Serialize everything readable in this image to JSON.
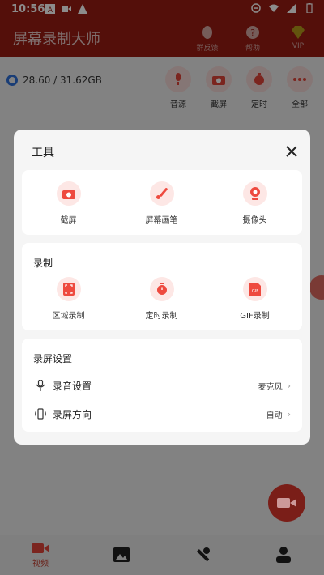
{
  "status": {
    "time": "10:56"
  },
  "app": {
    "title": "屏幕录制大师",
    "actions": [
      {
        "label": "群反馈",
        "icon": "qq-penguin-icon"
      },
      {
        "label": "帮助",
        "icon": "help-icon"
      },
      {
        "label": "VIP",
        "icon": "vip-diamond-icon"
      }
    ]
  },
  "storage": {
    "text": "28.60 / 31.62GB"
  },
  "quick": [
    {
      "label": "音源",
      "icon": "microphone-icon"
    },
    {
      "label": "截屏",
      "icon": "camera-icon"
    },
    {
      "label": "定时",
      "icon": "timer-icon"
    },
    {
      "label": "全部",
      "icon": "more-dots-icon"
    }
  ],
  "dialog": {
    "title": "工具",
    "tools": [
      {
        "label": "截屏",
        "icon": "camera-icon"
      },
      {
        "label": "屏幕画笔",
        "icon": "brush-icon"
      },
      {
        "label": "摄像头",
        "icon": "webcam-icon"
      }
    ],
    "record": {
      "title": "录制",
      "items": [
        {
          "label": "区域录制",
          "icon": "region-record-icon"
        },
        {
          "label": "定时录制",
          "icon": "timer-icon"
        },
        {
          "label": "GIF录制",
          "icon": "gif-icon"
        }
      ]
    },
    "settings": {
      "title": "录屏设置",
      "rows": [
        {
          "label": "录音设置",
          "value": "麦克风",
          "icon": "microphone-icon"
        },
        {
          "label": "录屏方向",
          "value": "自动",
          "icon": "rotate-icon"
        }
      ]
    }
  },
  "nav": [
    {
      "label": "视频",
      "icon": "video-icon"
    },
    {
      "label": "",
      "icon": "image-icon"
    },
    {
      "label": "",
      "icon": "wrench-icon"
    },
    {
      "label": "",
      "icon": "person-icon"
    }
  ],
  "colors": {
    "primary": "#9a1c13",
    "accent": "#ee4a3f",
    "icon_bg": "#fde7e5"
  }
}
